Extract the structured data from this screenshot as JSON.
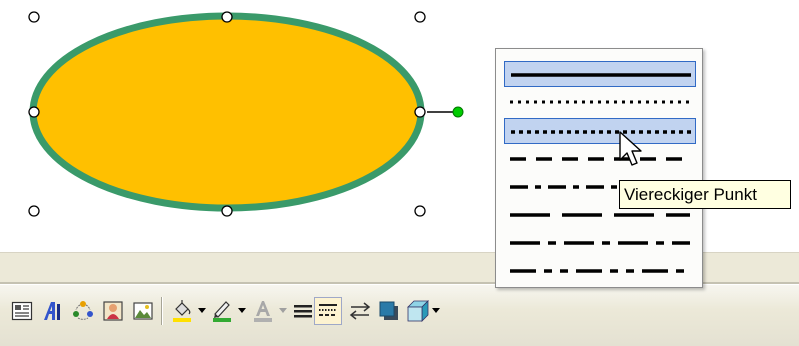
{
  "shape": {
    "fill_color": "#ffc000",
    "line_color": "#3a9a6a",
    "rotate_handle_color": "#00cc00"
  },
  "dash_menu": {
    "styles": [
      {
        "name": "solid",
        "selected": true
      },
      {
        "name": "round-dot",
        "selected": false
      },
      {
        "name": "square-dot",
        "selected": true
      },
      {
        "name": "dash",
        "selected": false
      },
      {
        "name": "dash-dot",
        "selected": false
      },
      {
        "name": "long-dash",
        "selected": false
      },
      {
        "name": "long-dash-dot",
        "selected": false
      },
      {
        "name": "long-dash-dot-dot",
        "selected": false
      }
    ],
    "highlight_color": "#c1d3f0"
  },
  "tooltip": {
    "text": "Viereckiger Punkt"
  },
  "toolbar": {
    "buttons": [
      {
        "name": "text-box-icon"
      },
      {
        "name": "wordart-icon"
      },
      {
        "name": "diagram-icon"
      },
      {
        "name": "clipart-icon"
      },
      {
        "name": "picture-icon"
      },
      {
        "name": "fill-color-icon",
        "color": "#ffe000"
      },
      {
        "name": "line-color-icon",
        "color": "#33aa33"
      },
      {
        "name": "font-color-icon",
        "color": "#b0b0b0"
      },
      {
        "name": "line-style-icon"
      },
      {
        "name": "dash-style-icon"
      },
      {
        "name": "arrow-style-icon"
      },
      {
        "name": "shadow-icon"
      },
      {
        "name": "3d-icon"
      }
    ]
  }
}
